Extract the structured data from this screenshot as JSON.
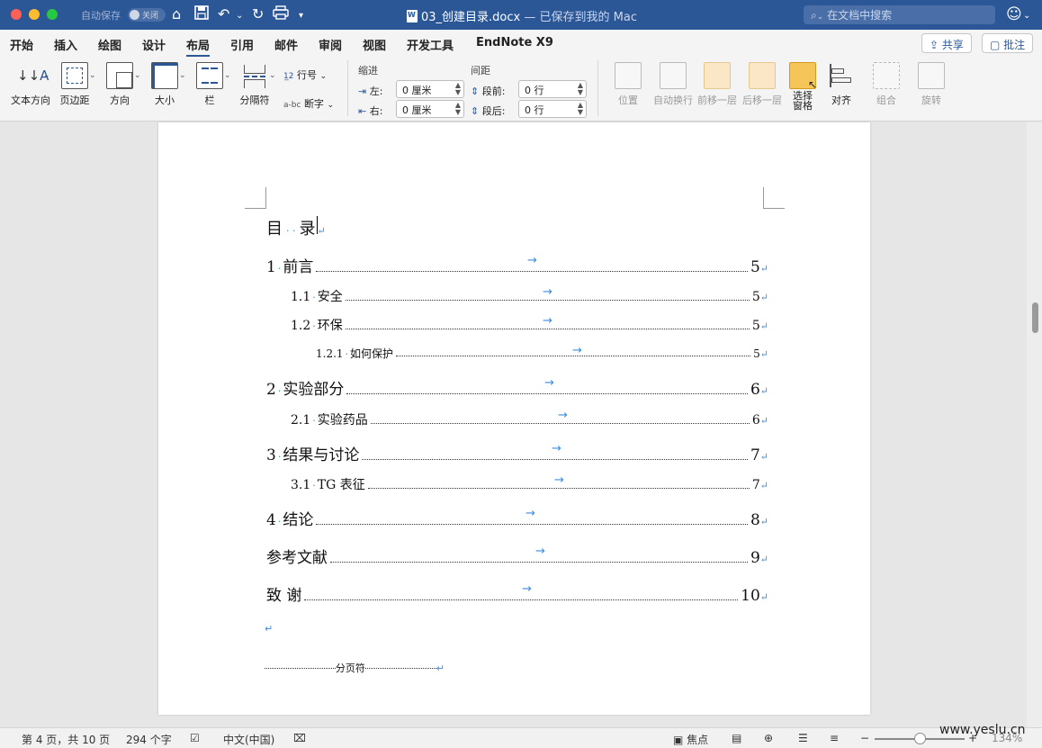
{
  "titlebar": {
    "autosave_label": "自动保存",
    "autosave_state": "关闭",
    "doc_name": "03_创建目录.docx",
    "saved_status": "— 已保存到我的 Mac",
    "search_placeholder": "在文档中搜索"
  },
  "tabs": [
    "开始",
    "插入",
    "绘图",
    "设计",
    "布局",
    "引用",
    "邮件",
    "审阅",
    "视图",
    "开发工具",
    "EndNote X9"
  ],
  "active_tab": "布局",
  "share_label": "共享",
  "comment_label": "批注",
  "ribbon": {
    "text_direction": "文本方向",
    "margins": "页边距",
    "orientation": "方向",
    "size": "大小",
    "columns": "栏",
    "breaks": "分隔符",
    "line_numbers": "行号",
    "hyphenation": "断字",
    "indent_label": "缩进",
    "spacing_label": "间距",
    "indent_left_label": "左:",
    "indent_left_value": "0 厘米",
    "indent_right_label": "右:",
    "indent_right_value": "0 厘米",
    "spacing_before_label": "段前:",
    "spacing_before_value": "0 行",
    "spacing_after_label": "段后:",
    "spacing_after_value": "0 行",
    "position": "位置",
    "wrap_text": "自动换行",
    "bring_forward": "前移一层",
    "send_backward": "后移一层",
    "selection_pane_1": "选择",
    "selection_pane_2": "窗格",
    "align": "对齐",
    "group": "组合",
    "rotate": "旋转"
  },
  "document": {
    "toc_title_a": "目",
    "toc_title_b": "录",
    "entries": [
      {
        "num": "1",
        "text": "前言",
        "page": "5"
      },
      {
        "num": "1.1",
        "text": "安全",
        "page": "5"
      },
      {
        "num": "1.2",
        "text": "环保",
        "page": "5"
      },
      {
        "num": "1.2.1",
        "text": "如何保护",
        "page": "5"
      },
      {
        "num": "2",
        "text": "实验部分",
        "page": "6"
      },
      {
        "num": "2.1",
        "text": "实验药品",
        "page": "6"
      },
      {
        "num": "3",
        "text": "结果与讨论",
        "page": "7"
      },
      {
        "num": "3.1",
        "text": "TG 表征",
        "page": "7"
      },
      {
        "num": "4",
        "text": "结论",
        "page": "8"
      },
      {
        "num": "",
        "text": "参考文献",
        "page": "9"
      },
      {
        "num": "",
        "text": "致  谢",
        "page": "10"
      }
    ],
    "page_break_label": "分页符"
  },
  "status": {
    "page_info": "第 4 页，共 10 页",
    "word_count": "294 个字",
    "language": "中文(中国)",
    "focus": "焦点",
    "zoom": "134%"
  },
  "watermark": "www.yeslu.cn"
}
